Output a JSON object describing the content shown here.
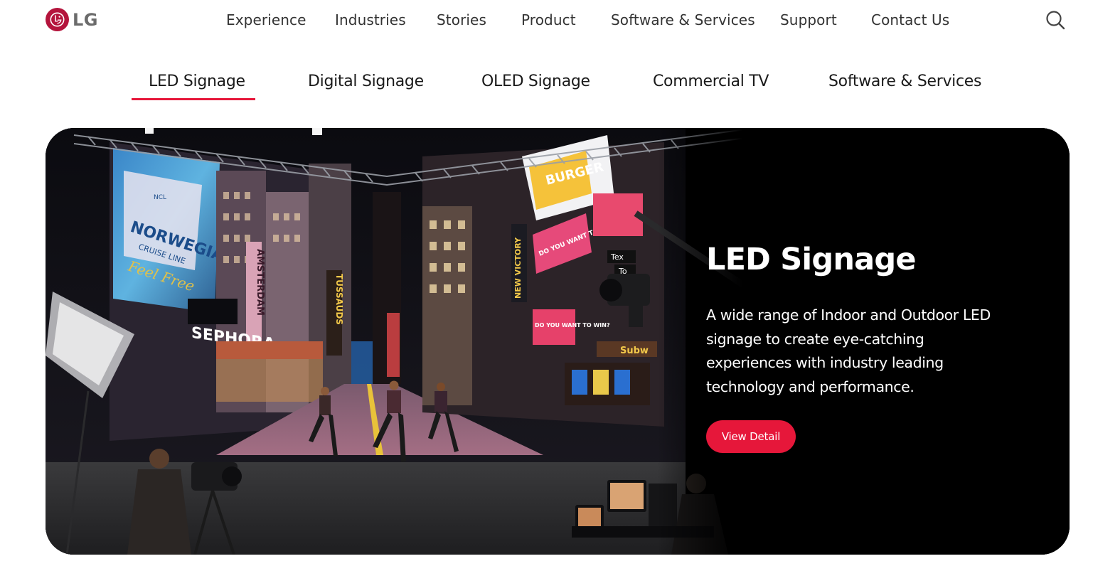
{
  "brand": {
    "logo_text": "LG",
    "accent_color": "#e6173a",
    "logo_color": "#b4143c"
  },
  "nav": {
    "items": [
      {
        "label": "Experience"
      },
      {
        "label": "Industries"
      },
      {
        "label": "Stories"
      },
      {
        "label": "Product"
      },
      {
        "label": "Software & Services"
      },
      {
        "label": "Support"
      },
      {
        "label": "Contact Us"
      }
    ],
    "search_icon": "search-icon"
  },
  "tabs": {
    "items": [
      {
        "label": "LED Signage"
      },
      {
        "label": "Digital Signage"
      },
      {
        "label": "OLED Signage"
      },
      {
        "label": "Commercial TV"
      },
      {
        "label": "Software & Services"
      }
    ],
    "selected": "LED Signage"
  },
  "hero": {
    "title": "LED Signage",
    "description": "A wide range of Indoor and Outdoor LED signage to create eye-catching experiences with industry leading technology and performance.",
    "button_label": "View Detail",
    "signs": {
      "norwegian_1": "NORWEGIAN",
      "norwegian_2": "CRUISE LINE",
      "norwegian_3": "Feel Free",
      "ncl": "NCL",
      "sephora": "SEPHORA",
      "amsterdam": "AMSTERDAM",
      "tussauds": "TUSSAUDS",
      "burger": "BURGER",
      "new_victory": "NEW VICTORY",
      "do_you_want_to_win_1": "DO YOU WANT TO WIN?",
      "do_you_want_to_win_2": "DO YOU WANT TO WIN?",
      "subway": "Subw",
      "text": "Tex",
      "to": "To"
    }
  }
}
